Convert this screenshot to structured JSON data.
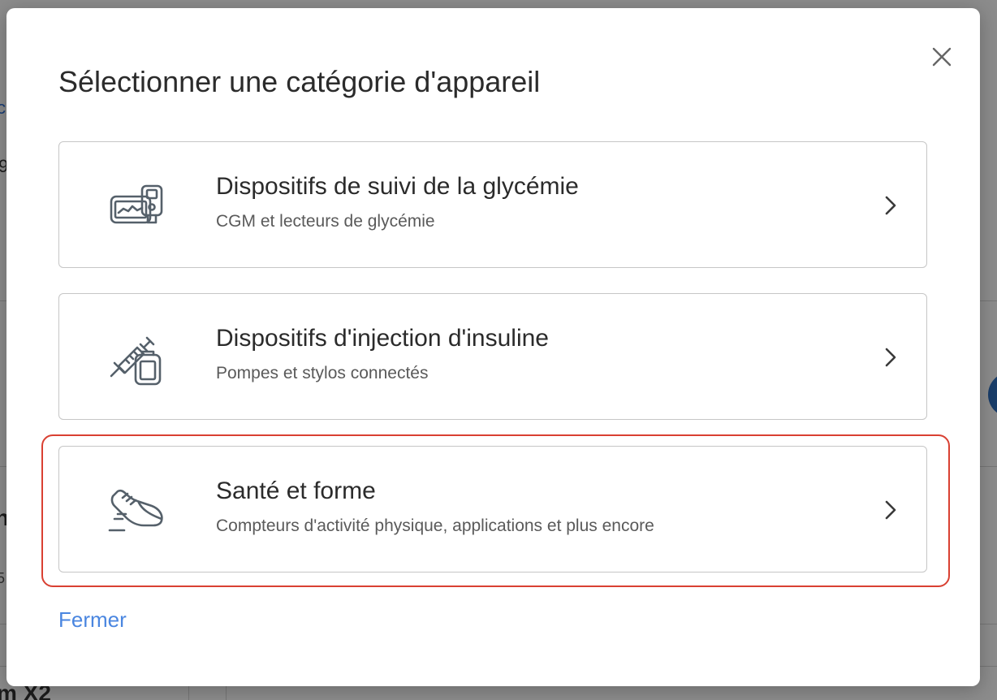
{
  "modal": {
    "title": "Sélectionner une catégorie d'appareil",
    "close_icon": "close-icon",
    "close_label": "Fermer",
    "categories": [
      {
        "title": "Dispositifs de suivi de la glycémie",
        "subtitle": "CGM et lecteurs de glycémie",
        "icon": "glucose-meter-icon"
      },
      {
        "title": "Dispositifs d'injection d'insuline",
        "subtitle": "Pompes et stylos connectés",
        "icon": "syringe-pump-icon"
      },
      {
        "title": "Santé et forme",
        "subtitle": "Compteurs d'activité physique, applications et plus encore",
        "icon": "sneaker-icon",
        "highlighted": true
      }
    ],
    "chevron_icon": "chevron-right-icon"
  },
  "background": {
    "fragments": [
      "c",
      "9",
      "n",
      "5",
      "m X2"
    ]
  },
  "colors": {
    "link": "#4a86e0",
    "highlight": "#d94032",
    "card_border": "#c6c6c6",
    "icon": "#55606a"
  }
}
